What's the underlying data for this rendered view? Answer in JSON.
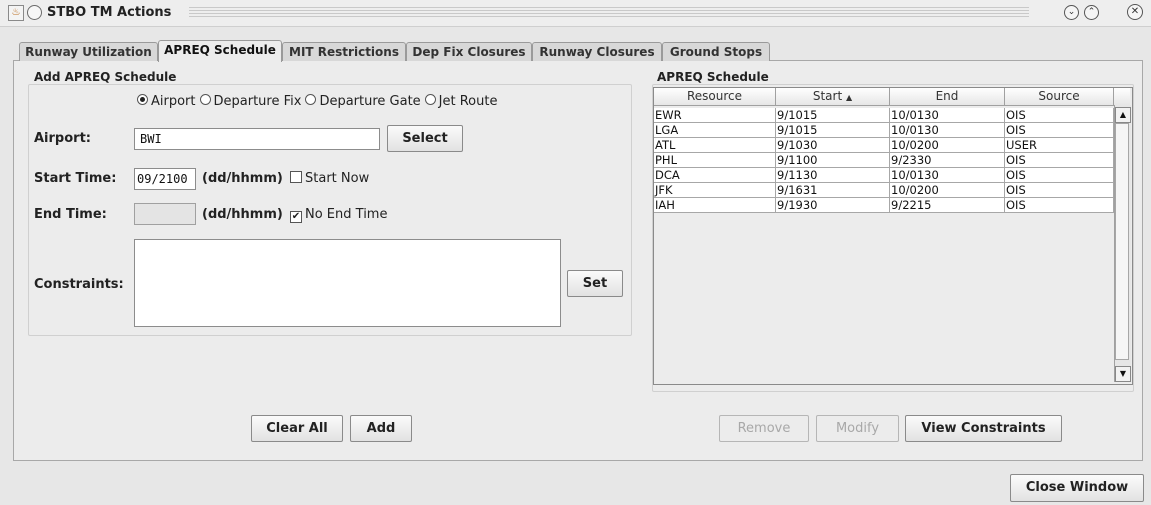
{
  "window": {
    "title": "STBO TM Actions",
    "icons": {
      "app": "java-cup-icon",
      "menu": "window-menu-icon",
      "minimize": "chevron-down-icon",
      "maximize": "chevron-up-icon",
      "close": "close-icon"
    }
  },
  "tabs": [
    {
      "label": "Runway Utilization",
      "active": false
    },
    {
      "label": "APREQ Schedule",
      "active": true
    },
    {
      "label": "MIT Restrictions",
      "active": false
    },
    {
      "label": "Dep Fix Closures",
      "active": false
    },
    {
      "label": "Runway Closures",
      "active": false
    },
    {
      "label": "Ground Stops",
      "active": false
    }
  ],
  "add_panel": {
    "title": "Add APREQ Schedule",
    "radio_options": [
      {
        "label": "Airport",
        "selected": true
      },
      {
        "label": "Departure Fix",
        "selected": false
      },
      {
        "label": "Departure Gate",
        "selected": false
      },
      {
        "label": "Jet Route",
        "selected": false
      }
    ],
    "airport_label": "Airport:",
    "airport_value": "BWI",
    "select_button": "Select",
    "start_label": "Start Time:",
    "start_value": "09/2100",
    "start_format": "(dd/hhmm)",
    "start_now_label": "Start Now",
    "start_now_checked": false,
    "end_label": "End Time:",
    "end_value": "",
    "end_format": "(dd/hhmm)",
    "no_end_label": "No End Time",
    "no_end_checked": true,
    "constraints_label": "Constraints:",
    "constraints_value": "",
    "set_button": "Set",
    "clear_all_button": "Clear All",
    "add_button": "Add"
  },
  "schedule_panel": {
    "title": "APREQ Schedule",
    "columns": [
      "Resource",
      "Start",
      "End",
      "Source"
    ],
    "sort_column": "Start",
    "sort_direction": "ascending",
    "rows": [
      {
        "resource": "EWR",
        "start": "9/1015",
        "end": "10/0130",
        "source": "OIS"
      },
      {
        "resource": "LGA",
        "start": "9/1015",
        "end": "10/0130",
        "source": "OIS"
      },
      {
        "resource": "ATL",
        "start": "9/1030",
        "end": "10/0200",
        "source": "USER"
      },
      {
        "resource": "PHL",
        "start": "9/1100",
        "end": "9/2330",
        "source": "OIS"
      },
      {
        "resource": "DCA",
        "start": "9/1130",
        "end": "10/0130",
        "source": "OIS"
      },
      {
        "resource": "JFK",
        "start": "9/1631",
        "end": "10/0200",
        "source": "OIS"
      },
      {
        "resource": "IAH",
        "start": "9/1930",
        "end": "9/2215",
        "source": "OIS"
      }
    ],
    "remove_button": "Remove",
    "modify_button": "Modify",
    "view_constraints_button": "View Constraints"
  },
  "footer": {
    "close_button": "Close Window"
  }
}
